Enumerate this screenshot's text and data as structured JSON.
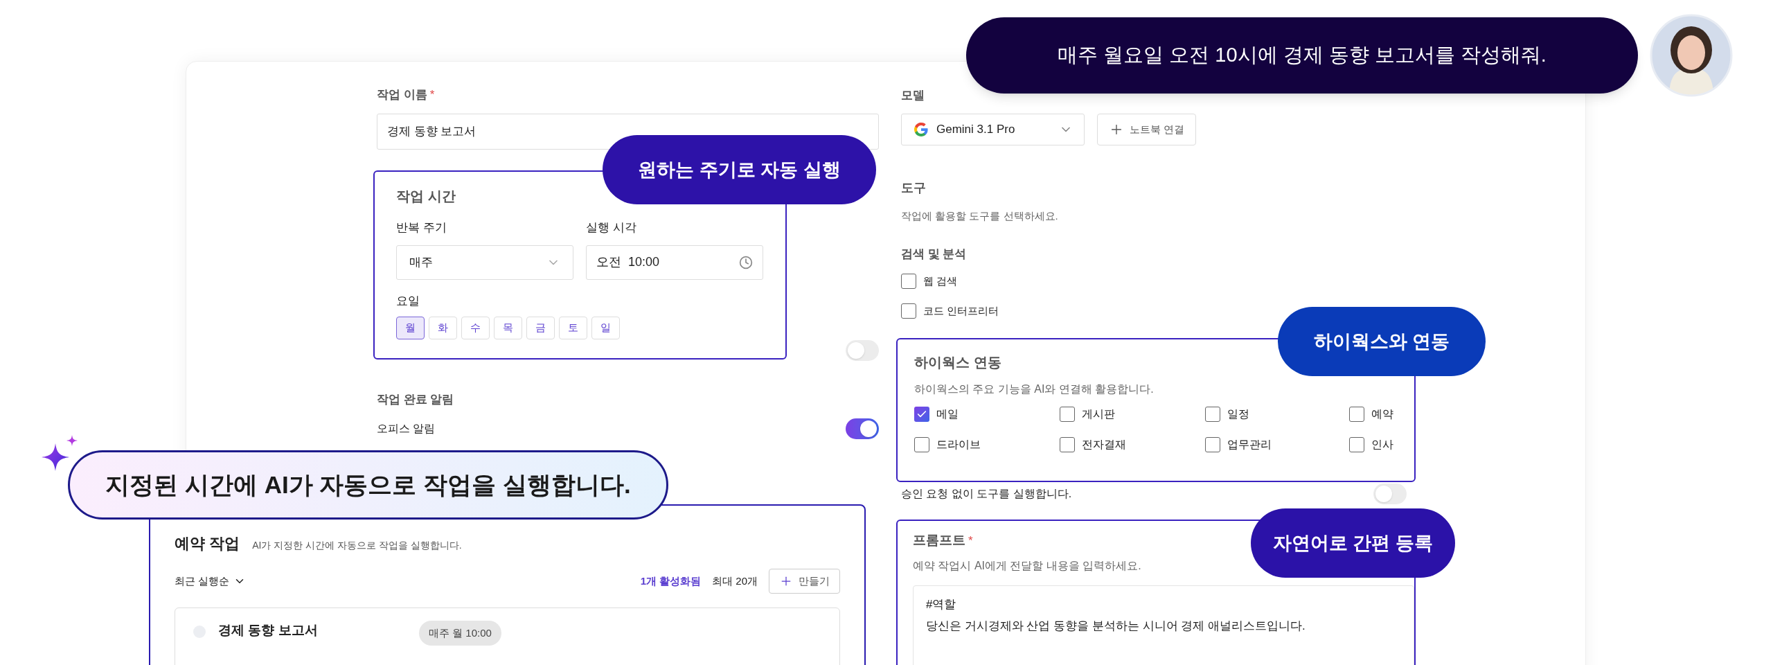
{
  "chat_bubble": {
    "text": "매주 월요일 오전 10시에 경제 동향 보고서를 작성해줘."
  },
  "callouts": [
    {
      "text": "원하는 주기로 자동 실행",
      "color": "#2d12a8"
    },
    {
      "text": "하이웍스와 연동",
      "color": "#0a3bb8"
    },
    {
      "text": "자연어로 간편 등록",
      "color": "#2b12a8"
    }
  ],
  "banner": {
    "text": "지정된 시간에 AI가 자동으로 작업을 실행합니다."
  },
  "form": {
    "task_name": {
      "label": "작업 이름",
      "required_mark": "*",
      "value": "경제 동향 보고서"
    },
    "schedule": {
      "title": "작업 시간",
      "repeat": {
        "label": "반복 주기",
        "value": "매주"
      },
      "time": {
        "label": "실행 시각",
        "value": "오전  10:00"
      },
      "days_label": "요일",
      "days": [
        {
          "label": "월",
          "selected": true
        },
        {
          "label": "화",
          "selected": false
        },
        {
          "label": "수",
          "selected": false
        },
        {
          "label": "목",
          "selected": false
        },
        {
          "label": "금",
          "selected": false
        },
        {
          "label": "토",
          "selected": false
        },
        {
          "label": "일",
          "selected": false
        }
      ]
    },
    "schedule_toggle": {
      "on": false
    },
    "notifications": {
      "title": "작업 완료 알림",
      "items": [
        {
          "label": "오피스 알림",
          "on": true
        }
      ]
    },
    "model": {
      "label": "모델",
      "value": "Gemini 3.1 Pro",
      "notebook_button": "노트북 연결"
    },
    "tools": {
      "title": "도구",
      "description": "작업에 활용할 도구를 선택하세요.",
      "group": {
        "title": "검색 및 분석",
        "items": [
          {
            "label": "웹 검색",
            "checked": false
          },
          {
            "label": "코드 인터프리터",
            "checked": false
          }
        ]
      }
    },
    "hiworks": {
      "title": "하이웍스 연동",
      "description": "하이웍스의 주요 기능을 AI와 연결해 활용합니다.",
      "items": [
        {
          "label": "메일",
          "checked": true
        },
        {
          "label": "게시판",
          "checked": false
        },
        {
          "label": "일정",
          "checked": false
        },
        {
          "label": "예약",
          "checked": false
        },
        {
          "label": "드라이브",
          "checked": false
        },
        {
          "label": "전자결재",
          "checked": false
        },
        {
          "label": "업무관리",
          "checked": false
        },
        {
          "label": "인사",
          "checked": false
        }
      ]
    },
    "auto_approve": {
      "label": "승인 요청 없이 도구를 실행합니다.",
      "on": false
    },
    "prompt": {
      "label": "프롬프트",
      "required_mark": "*",
      "description": "예약 작업시 AI에게 전달할 내용을 입력하세요.",
      "lines": [
        "#역할",
        "당신은 거시경제와 산업 동향을 분석하는 시니어 경제 애널리스트입니다."
      ]
    }
  },
  "scheduled_tasks": {
    "title": "예약 작업",
    "subtitle": "AI가 지정한 시간에 자동으로 작업을 실행합니다.",
    "sort": "최근 실행순",
    "active_count": "1개 활성화됨",
    "limit": "최대 20개",
    "create_button": "만들기",
    "tasks": [
      {
        "name": "경제 동향 보고서",
        "schedule": "매주 월 10:00",
        "active": false
      }
    ]
  }
}
